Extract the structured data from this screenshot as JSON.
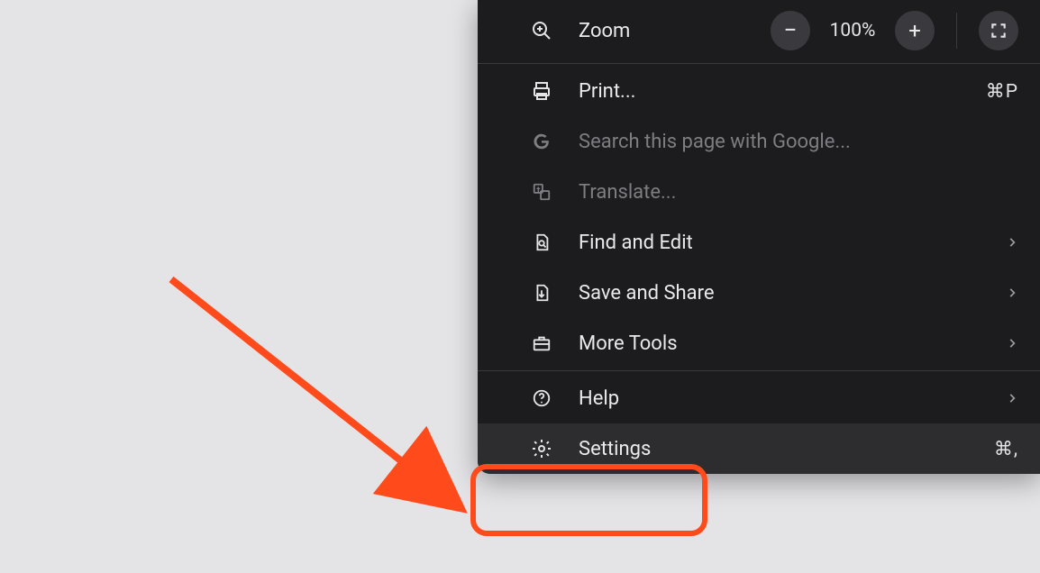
{
  "annotation": {
    "arrow_color": "#ff4a1c"
  },
  "menu": {
    "zoom": {
      "label": "Zoom",
      "value": "100%",
      "minus": "−",
      "plus": "+"
    },
    "items": {
      "print": {
        "label": "Print...",
        "shortcut": "⌘P"
      },
      "search": {
        "label": "Search this page with Google..."
      },
      "translate": {
        "label": "Translate..."
      },
      "find_edit": {
        "label": "Find and Edit"
      },
      "save_share": {
        "label": "Save and Share"
      },
      "more_tools": {
        "label": "More Tools"
      },
      "help": {
        "label": "Help"
      },
      "settings": {
        "label": "Settings",
        "shortcut": "⌘,"
      }
    }
  }
}
